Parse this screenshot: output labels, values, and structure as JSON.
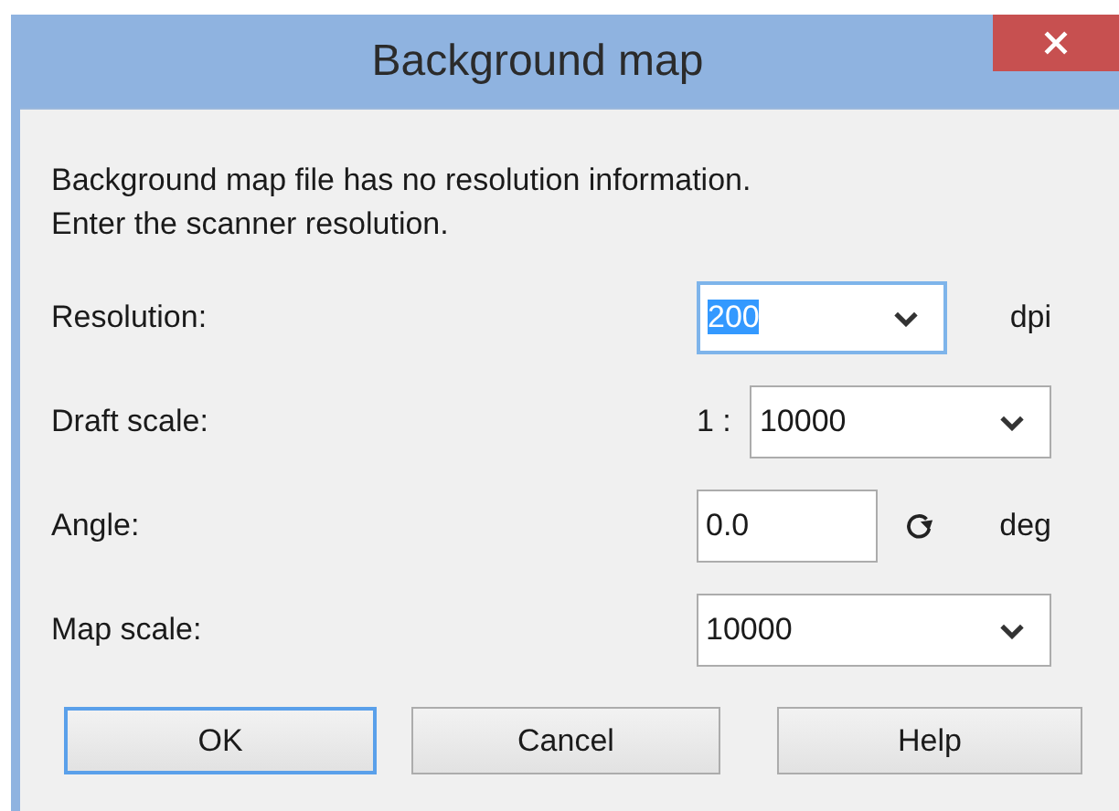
{
  "window": {
    "title": "Background map"
  },
  "message": [
    "Background map file has no resolution information.",
    "Enter the scanner resolution."
  ],
  "fields": [
    {
      "label": "Resolution:",
      "kind": "combo",
      "value": "200",
      "focused": true,
      "unit": "dpi"
    },
    {
      "label": "Draft scale:",
      "kind": "combo",
      "prefix": "1 :",
      "value": "10000",
      "focused": false
    },
    {
      "label": "Angle:",
      "kind": "input",
      "value": "0.0",
      "focused": false,
      "unit": "deg"
    },
    {
      "label": "Map scale:",
      "kind": "combo",
      "value": "10000",
      "focused": false
    }
  ],
  "buttons": [
    {
      "label": "OK",
      "focused": true
    },
    {
      "label": "Cancel",
      "focused": false
    },
    {
      "label": "Help",
      "focused": false
    }
  ]
}
